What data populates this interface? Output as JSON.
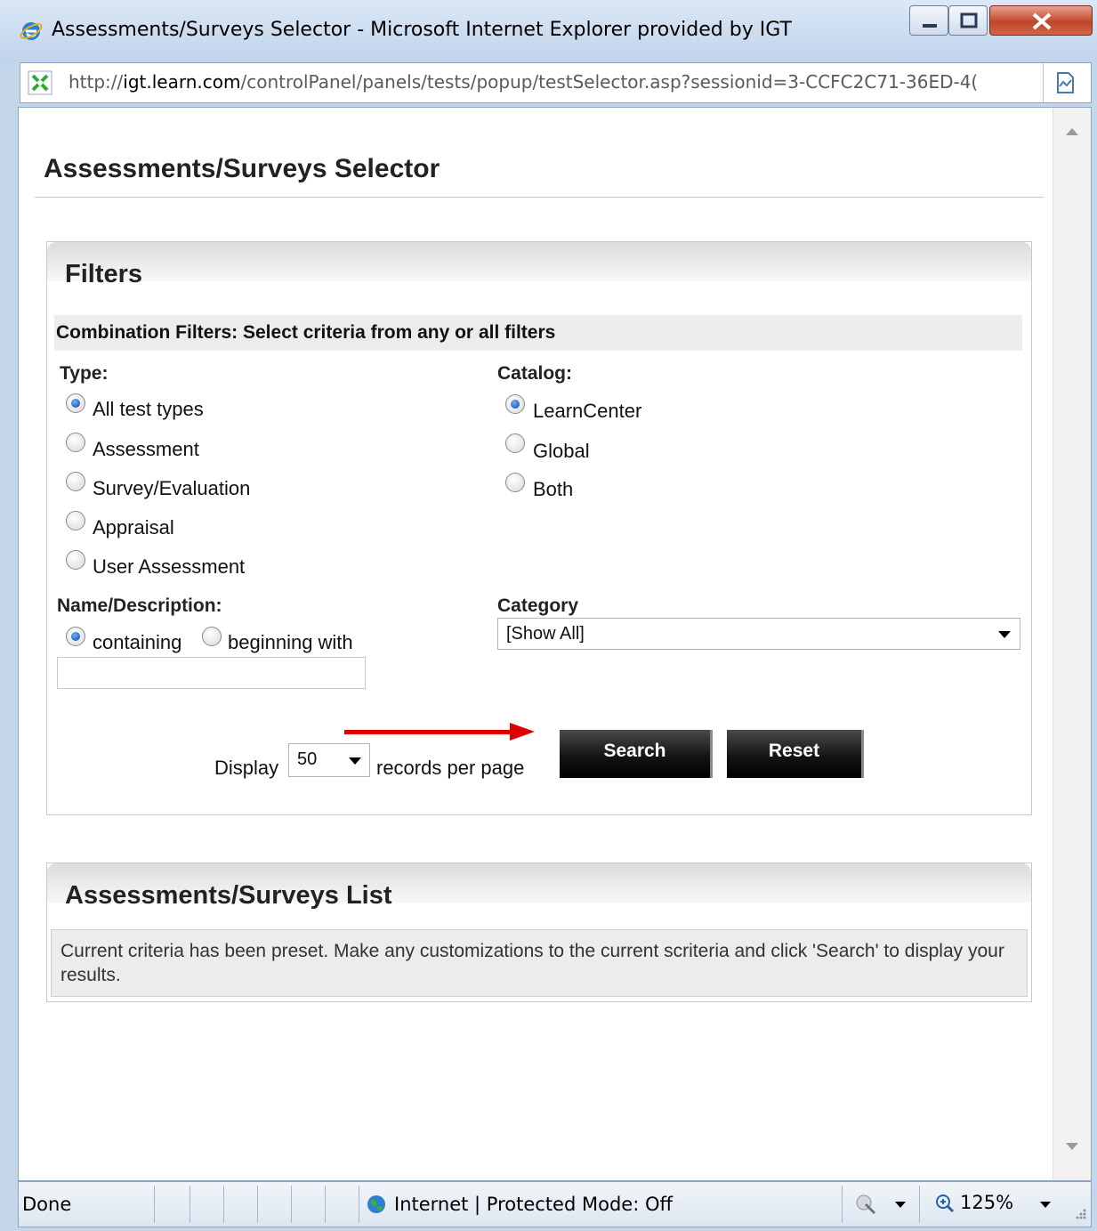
{
  "window": {
    "title": "Assessments/Surveys Selector - Microsoft Internet Explorer provided by IGT",
    "colors": {
      "chrome": "#c4d6ea",
      "close": "#c0462b"
    }
  },
  "address": {
    "prefix": "http://",
    "domain": "igt.learn.com",
    "path": "/controlPanel/panels/tests/popup/testSelector.asp?sessionid=3-CCFC2C71-36ED-4("
  },
  "page": {
    "title": "Assessments/Surveys Selector"
  },
  "filters": {
    "header": "Filters",
    "combination_text": "Combination Filters: Select criteria from any or all filters",
    "type": {
      "label": "Type:",
      "options": [
        {
          "label": "All test types",
          "selected": true
        },
        {
          "label": "Assessment",
          "selected": false
        },
        {
          "label": "Survey/Evaluation",
          "selected": false
        },
        {
          "label": "Appraisal",
          "selected": false
        },
        {
          "label": "User Assessment",
          "selected": false
        }
      ]
    },
    "catalog": {
      "label": "Catalog:",
      "options": [
        {
          "label": "LearnCenter",
          "selected": true
        },
        {
          "label": "Global",
          "selected": false
        },
        {
          "label": "Both",
          "selected": false
        }
      ]
    },
    "name_description": {
      "label": "Name/Description:",
      "options": [
        {
          "label": "containing",
          "selected": true
        },
        {
          "label": "beginning with",
          "selected": false
        }
      ],
      "value": ""
    },
    "category": {
      "label": "Category",
      "selected": "[Show All]"
    },
    "display": {
      "prefix": "Display",
      "value": "50",
      "suffix": "records per page"
    },
    "search_label": "Search",
    "reset_label": "Reset",
    "arrow_color": "#e00000"
  },
  "list": {
    "header": "Assessments/Surveys List",
    "message": "Current criteria has been preset. Make any customizations to the current scriteria and click 'Search' to display your results."
  },
  "status": {
    "text": "Done",
    "zone": "Internet | Protected Mode: Off",
    "zoom": "125%"
  }
}
